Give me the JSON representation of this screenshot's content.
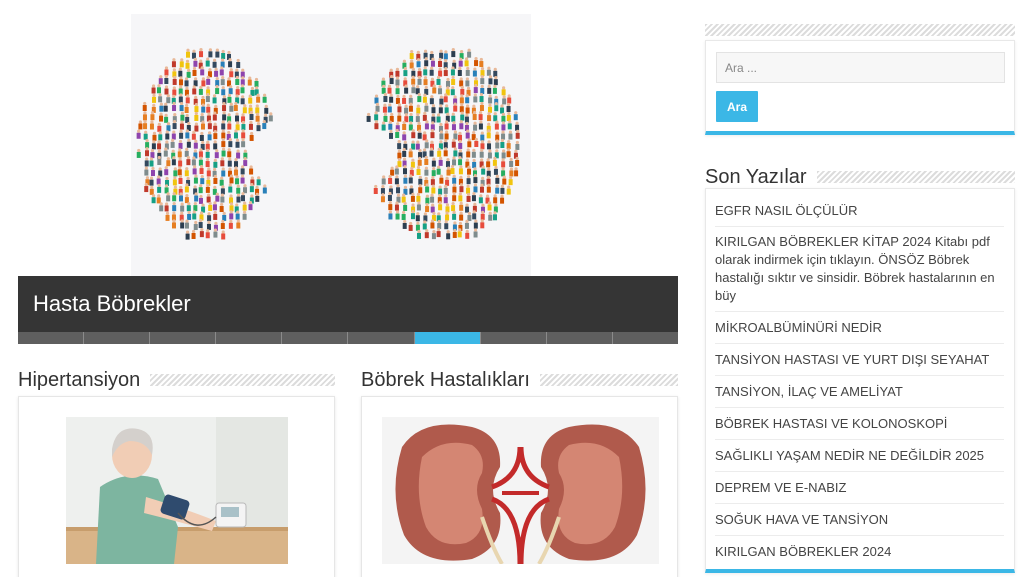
{
  "slider": {
    "caption": "Hasta Böbrekler",
    "dot_count": 10,
    "active_index": 6
  },
  "sections": {
    "hipertansiyon": {
      "title": "Hipertansiyon"
    },
    "bobrek": {
      "title": "Böbrek Hastalıkları"
    }
  },
  "search": {
    "placeholder": "Ara ...",
    "button_label": "Ara"
  },
  "recent_posts": {
    "title": "Son Yazılar",
    "items": [
      "EGFR NASIL ÖLÇÜLÜR",
      "KIRILGAN BÖBREKLER KİTAP 2024 Kitabı pdf olarak indirmek için tıklayın. ÖNSÖZ Böbrek hastalığı sıktır ve sinsidir. Böbrek hastalarının en büy",
      "MİKROALBÜMİNÜRİ NEDİR",
      "TANSİYON HASTASI VE YURT DIŞI SEYAHAT",
      "TANSİYON, İLAÇ VE AMELİYAT",
      "BÖBREK HASTASI VE KOLONOSKOPİ",
      "SAĞLIKLI YAŞAM NEDİR NE DEĞİLDİR 2025",
      "DEPREM VE E-NABIZ",
      "SOĞUK HAVA VE TANSİYON",
      "KIRILGAN BÖBREKLER 2024"
    ]
  },
  "colors": {
    "accent": "#3bb7e6",
    "caption_bg": "#353535",
    "dot_inactive": "#5f5f5f"
  }
}
